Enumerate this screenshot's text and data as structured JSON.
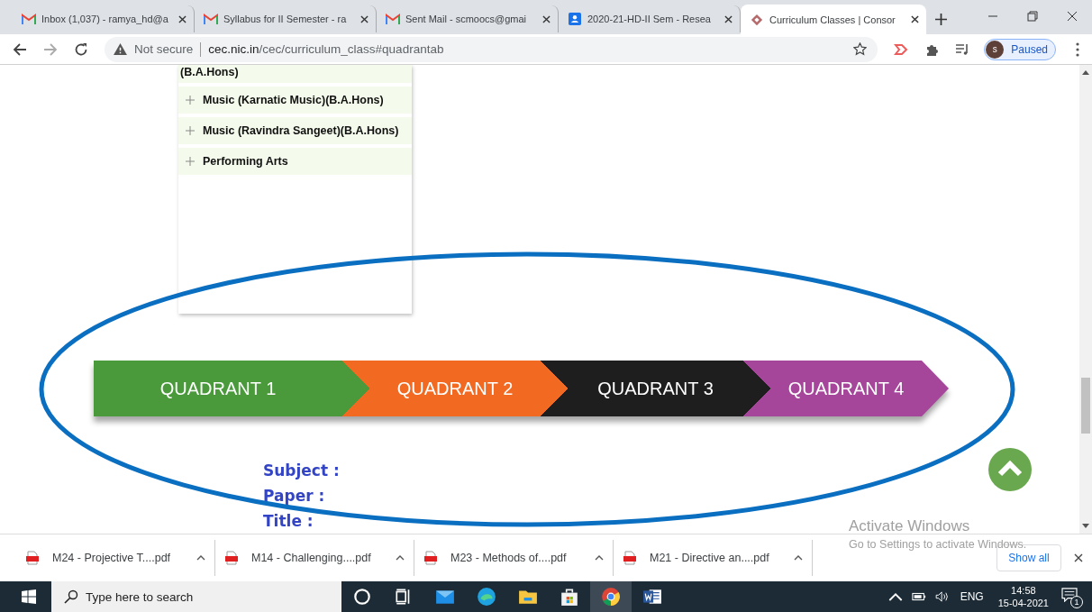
{
  "browser": {
    "tabs": [
      {
        "kind": "gmail",
        "title": "Inbox (1,037) - ramya_hd@a",
        "selected": false
      },
      {
        "kind": "gmail",
        "title": "Syllabus for II Semester - ra",
        "selected": false
      },
      {
        "kind": "gmail",
        "title": "Sent Mail - scmoocs@gmai",
        "selected": false
      },
      {
        "kind": "contacts",
        "title": "2020-21-HD-II Sem - Resea",
        "selected": false
      },
      {
        "kind": "site",
        "title": "Curriculum Classes | Consor",
        "selected": true
      }
    ],
    "security": "Not secure",
    "address_host": "cec.nic.in",
    "address_path": "/cec/curriculum_class#quadrantab",
    "profile": {
      "initial": "s",
      "label": "Paused"
    }
  },
  "course_list": {
    "fragment": "(B.A.Hons)",
    "items": [
      {
        "label": "Music (Karnatic Music)(B.A.Hons)",
        "expanded": false
      },
      {
        "label": "Music (Ravindra Sangeet)(B.A.Hons)",
        "expanded": false
      },
      {
        "label": "Performing Arts",
        "expanded": false
      }
    ]
  },
  "quadrants": [
    {
      "label": "QUADRANT 1",
      "color": "#4a9a3c"
    },
    {
      "label": "QUADRANT 2",
      "color": "#f26a22"
    },
    {
      "label": "QUADRANT 3",
      "color": "#1e1e1e"
    },
    {
      "label": "QUADRANT 4",
      "color": "#a5469a"
    }
  ],
  "details": [
    "Subject :",
    "Paper :",
    "Title :"
  ],
  "downloads": {
    "files": [
      "M24 - Projective T....pdf",
      "M14 - Challenging....pdf",
      "M23 - Methods of....pdf",
      "M21 - Directive an....pdf"
    ],
    "show_all": "Show all"
  },
  "activation": {
    "title": "Activate Windows",
    "subtitle": "Go to Settings to activate Windows."
  },
  "taskbar": {
    "search_placeholder": "Type here to search",
    "apps": [
      {
        "kind": "cortana",
        "selected": false
      },
      {
        "kind": "taskview",
        "selected": false
      },
      {
        "kind": "mail",
        "selected": false
      },
      {
        "kind": "edge",
        "selected": false
      },
      {
        "kind": "explorer",
        "selected": false
      },
      {
        "kind": "store",
        "selected": false
      },
      {
        "kind": "chrome",
        "selected": true
      },
      {
        "kind": "word",
        "selected": false
      }
    ],
    "language": "ENG",
    "time": "14:58",
    "date": "15-04-2021",
    "notifications": "1"
  }
}
